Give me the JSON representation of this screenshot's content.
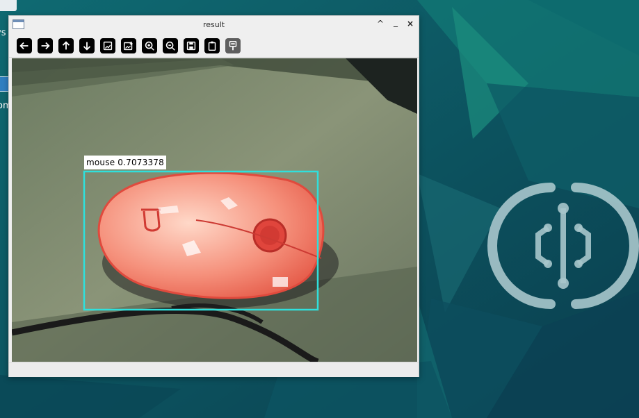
{
  "window": {
    "title": "result"
  },
  "titlebar_buttons": {
    "maximize": "^",
    "minimize": "_",
    "close": "×"
  },
  "toolbar": {
    "icons": [
      "arrow-left-icon",
      "arrow-right-icon",
      "arrow-up-icon",
      "arrow-down-icon",
      "image-icon",
      "image-save-icon",
      "zoom-in-icon",
      "zoom-out-icon",
      "save-icon",
      "clipboard-icon",
      "properties-icon"
    ]
  },
  "detection": {
    "label": "mouse 0.7073378",
    "box_color": "#2fe0dc"
  },
  "desktop": {
    "icon_label_1": "ys",
    "icon_label_2": "om"
  }
}
